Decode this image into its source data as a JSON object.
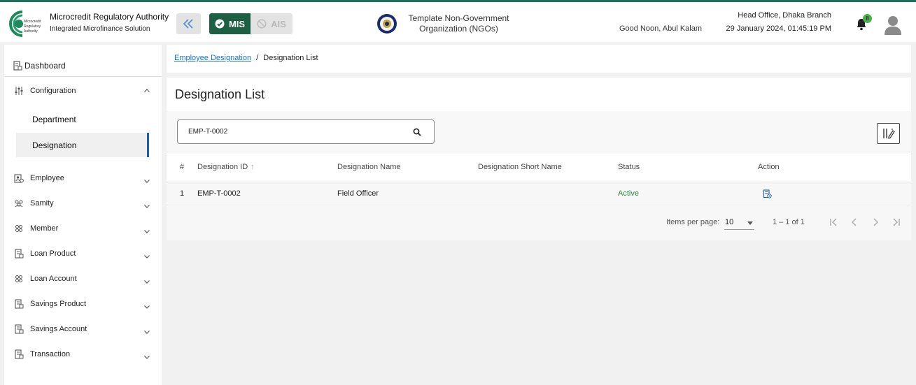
{
  "app": {
    "org_name_line1": "Microcredit Regulatory Authority",
    "org_tagline": "Integrated Microfinance Solution",
    "logo_text": "Microcredit Regulatory Authority",
    "mis_label": "MIS",
    "ais_label": "AIS",
    "ngo_name": "Template Non-Government Organization (NGOs)",
    "greeting": "Good Noon, Abul Kalam",
    "branch": "Head Office, Dhaka Branch",
    "datetime": "29 January 2024, 01:45:19 PM",
    "notification_count": "8",
    "brand_color": "#1c5f43",
    "accent_color": "#1f5fa8"
  },
  "sidebar": {
    "dashboard": "Dashboard",
    "configuration": "Configuration",
    "sub_items": [
      "Department",
      "Designation"
    ],
    "items": [
      "Employee",
      "Samity",
      "Member",
      "Loan Product",
      "Loan Account",
      "Savings Product",
      "Savings Account",
      "Transaction"
    ]
  },
  "breadcrumb": {
    "parent": "Employee Designation",
    "separator": "/",
    "current": "Designation List"
  },
  "page": {
    "title": "Designation List",
    "search_value": "EMP-T-0002"
  },
  "table": {
    "headers": [
      "#",
      "Designation ID",
      "Designation Name",
      "Designation Short Name",
      "Status",
      "Action"
    ],
    "sort_indicator": "↑",
    "rows": [
      {
        "num": "1",
        "id": "EMP-T-0002",
        "name": "Field Officer",
        "short_name": "",
        "status": "Active"
      }
    ]
  },
  "pager": {
    "items_per_page_label": "Items per page:",
    "items_per_page": "10",
    "range": "1 – 1 of 1"
  }
}
